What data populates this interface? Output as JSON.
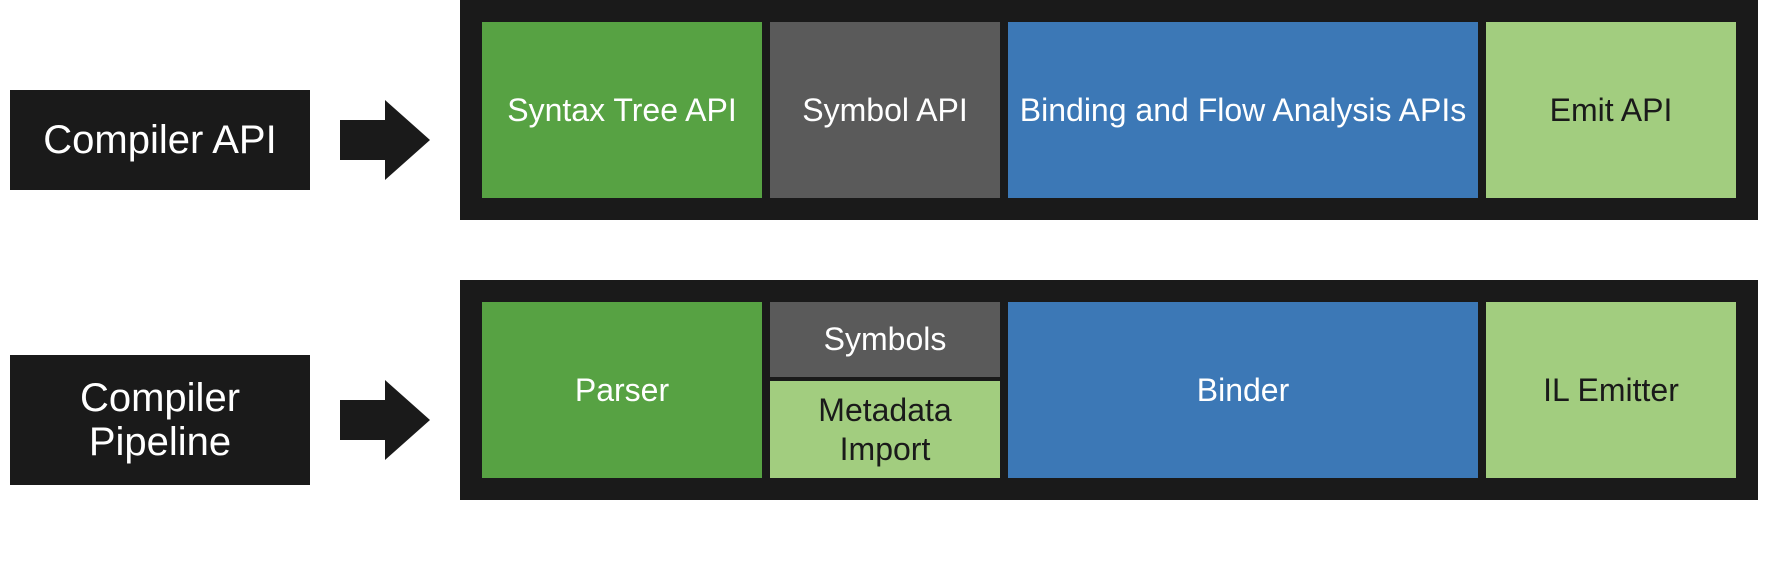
{
  "rows": {
    "api": {
      "label": "Compiler API",
      "stages": {
        "syntax": "Syntax Tree API",
        "symbol": "Symbol API",
        "binding": "Binding and Flow Analysis APIs",
        "emit": "Emit API"
      }
    },
    "pipeline": {
      "label": "Compiler Pipeline",
      "stages": {
        "parser": "Parser",
        "symbols": "Symbols",
        "metadata": "Metadata Import",
        "binder": "Binder",
        "emitter": "IL Emitter"
      }
    }
  },
  "colors": {
    "background_dark": "#1a1a1a",
    "green": "#57a243",
    "gray": "#5a5a5a",
    "blue": "#3c78b6",
    "lightgreen": "#a2cd7f"
  }
}
